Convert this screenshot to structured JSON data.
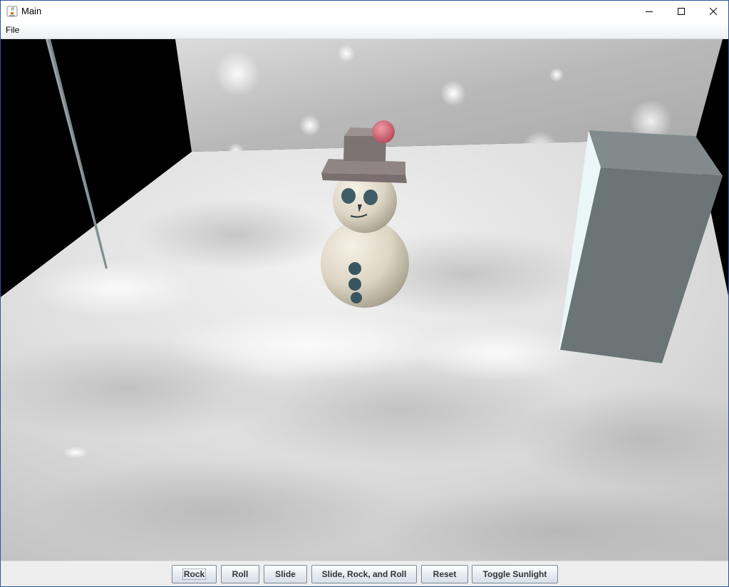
{
  "window": {
    "title": "Main",
    "icon": "java-app-icon"
  },
  "menubar": {
    "items": [
      {
        "label": "File"
      }
    ]
  },
  "scene": {
    "description_icons": [
      "snowman",
      "gift-box",
      "icicle",
      "snow-floor",
      "back-wall"
    ],
    "colors": {
      "background": "#000000",
      "wall": "#c8c8c8",
      "floor": "#e6e6e6",
      "box_front": "#6a7475",
      "box_side": "#e8f4f6",
      "hat": "#7a6f6f",
      "pompom": "#d46a78",
      "snow_body": "#e4ddd0",
      "buttons": "#3c5a66"
    }
  },
  "buttons": [
    {
      "label": "Rock",
      "focused": true
    },
    {
      "label": "Roll"
    },
    {
      "label": "Slide"
    },
    {
      "label": "Slide, Rock, and Roll"
    },
    {
      "label": "Reset"
    },
    {
      "label": "Toggle Sunlight"
    }
  ]
}
